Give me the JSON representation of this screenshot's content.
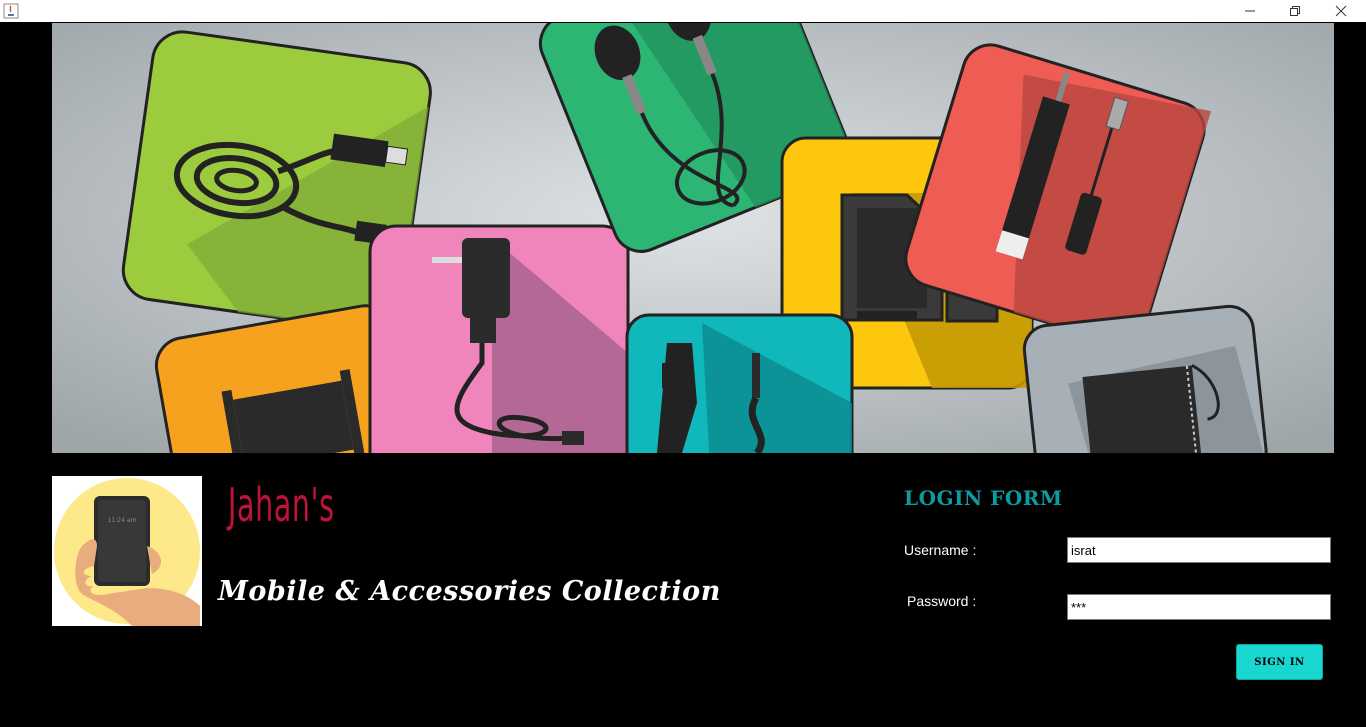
{
  "window": {
    "title": ""
  },
  "banner": {
    "description": "mobile accessories illustration"
  },
  "brand": {
    "name": "Jahan's",
    "tagline": "Mobile & Accessories Collection",
    "logo_time": "11:24 am"
  },
  "login": {
    "title": "LOGIN FORM",
    "username_label": "Username  :",
    "password_label": "Password  :",
    "username_value": "israt",
    "password_value": "***",
    "signin_label": "SIGN IN"
  },
  "colors": {
    "brand": "#c1123a",
    "form_title": "#0f9aa0",
    "signin_bg": "#19d6cf"
  }
}
